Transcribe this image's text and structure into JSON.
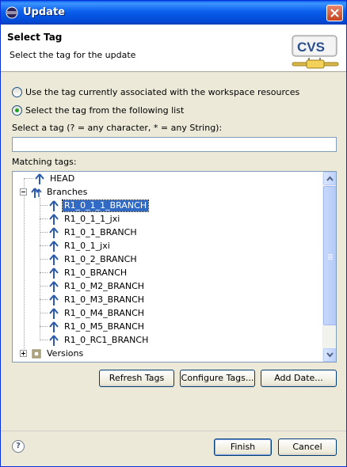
{
  "window": {
    "title": "Update"
  },
  "banner": {
    "title": "Select Tag",
    "description": "Select the tag for the update",
    "logo_text": "CVS"
  },
  "options": {
    "radio_workspace": "Use the tag currently associated with the workspace resources",
    "radio_workspace_checked": false,
    "radio_list": "Select the tag from the following list",
    "radio_list_checked": true
  },
  "filter": {
    "label": "Select a tag (? = any character, * = any String):",
    "value": ""
  },
  "matching": {
    "label": "Matching tags:",
    "head": "HEAD",
    "branches_label": "Branches",
    "branches": [
      "R1_0_1_1_BRANCH",
      "R1_0_1_1_jxi",
      "R1_0_1_BRANCH",
      "R1_0_1_jxi",
      "R1_0_2_BRANCH",
      "R1_0_BRANCH",
      "R1_0_M2_BRANCH",
      "R1_0_M3_BRANCH",
      "R1_0_M4_BRANCH",
      "R1_0_M5_BRANCH",
      "R1_0_RC1_BRANCH"
    ],
    "selected": "R1_0_1_1_BRANCH",
    "versions_label": "Versions"
  },
  "actions": {
    "refresh": "Refresh Tags",
    "configure": "Configure Tags...",
    "add_date": "Add Date..."
  },
  "footer": {
    "help": "?",
    "finish": "Finish",
    "cancel": "Cancel"
  },
  "colors": {
    "title_bar": "#0a5fec",
    "selection": "#316ac5",
    "tag_icon": "#2a5aa8",
    "radio_dot": "#21a121"
  }
}
